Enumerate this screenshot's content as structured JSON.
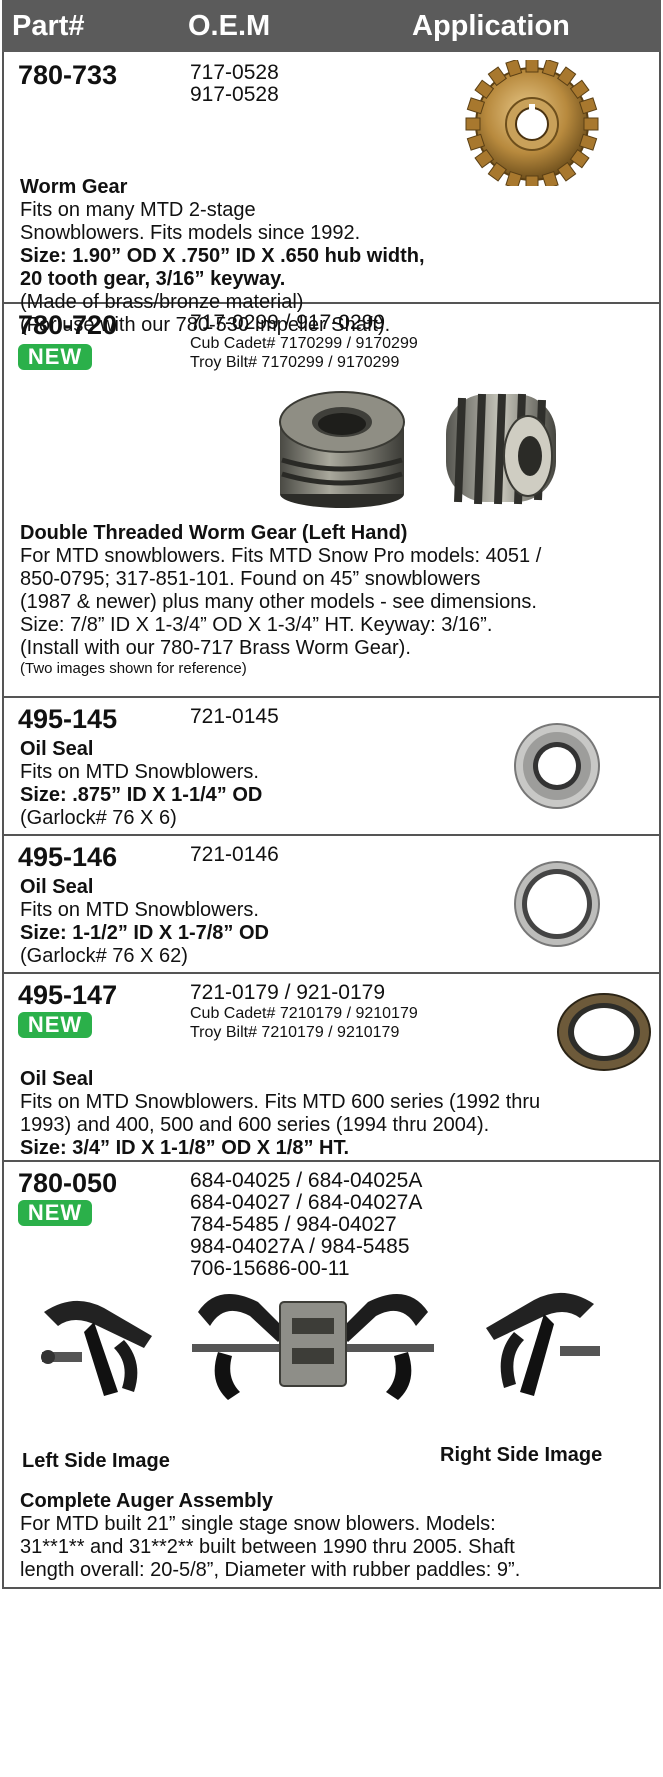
{
  "header": {
    "part": "Part#",
    "oem": "O.E.M",
    "application": "Application"
  },
  "new_badge": "NEW",
  "items": [
    {
      "part": "780-733",
      "oem": [
        "717-0528",
        "917-0528"
      ],
      "title": "Worm Gear",
      "lines": [
        "Fits on many MTD 2-stage",
        "Snowblowers. Fits models since 1992."
      ],
      "bold_lines": [
        "Size: 1.90” OD X .750” ID X .650 hub width,",
        "20 tooth gear, 3/16” keyway."
      ],
      "notes": [
        "(Made of brass/bronze material)",
        "(For use with our 780-530 Impeller Shaft)."
      ]
    },
    {
      "part": "780-720",
      "oem": [
        "717-0299 / 917-0299"
      ],
      "oem_small": [
        "Cub Cadet# 7170299 / 9170299",
        "Troy Bilt# 7170299 / 9170299"
      ],
      "title": "Double Threaded Worm Gear (Left Hand)",
      "lines": [
        "For MTD snowblowers. Fits MTD Snow Pro models: 4051 /",
        "850-0795; 317-851-101. Found on 45” snowblowers",
        "(1987 & newer) plus many other models - see dimensions.",
        "Size: 7/8” ID X 1-3/4” OD X 1-3/4” HT. Keyway: 3/16”.",
        "(Install with our 780-717 Brass Worm Gear)."
      ],
      "small_note": "(Two images shown for reference)"
    },
    {
      "part": "495-145",
      "oem": [
        "721-0145"
      ],
      "title": "Oil Seal",
      "lines": [
        "Fits on MTD Snowblowers."
      ],
      "bold_lines": [
        "Size: .875” ID X 1-1/4” OD"
      ],
      "notes": [
        "(Garlock# 76 X 6)"
      ]
    },
    {
      "part": "495-146",
      "oem": [
        "721-0146"
      ],
      "title": "Oil Seal",
      "lines": [
        "Fits on MTD Snowblowers."
      ],
      "bold_lines": [
        "Size: 1-1/2” ID X 1-7/8” OD"
      ],
      "notes": [
        "(Garlock# 76 X 62)"
      ]
    },
    {
      "part": "495-147",
      "oem": [
        "721-0179 / 921-0179"
      ],
      "oem_small": [
        "Cub Cadet# 7210179 / 9210179",
        "Troy Bilt# 7210179 / 9210179"
      ],
      "title": "Oil Seal",
      "lines": [
        "Fits on MTD Snowblowers. Fits MTD 600 series (1992 thru",
        "1993) and 400, 500 and 600 series (1994 thru 2004)."
      ],
      "bold_lines": [
        "Size: 3/4” ID X 1-1/8” OD X 1/8” HT."
      ]
    },
    {
      "part": "780-050",
      "oem": [
        "684-04025 / 684-04025A",
        "684-04027 / 684-04027A",
        "784-5485 / 984-04027",
        "984-04027A / 984-5485",
        "706-15686-00-11"
      ],
      "left_caption": "Left Side Image",
      "right_caption": "Right Side Image",
      "title": "Complete Auger Assembly",
      "lines": [
        "For MTD built 21” single stage snow blowers. Models:",
        "31**1** and 31**2** built between 1990 thru 2005. Shaft",
        "length overall: 20-5/8”, Diameter with rubber paddles: 9”."
      ]
    }
  ]
}
